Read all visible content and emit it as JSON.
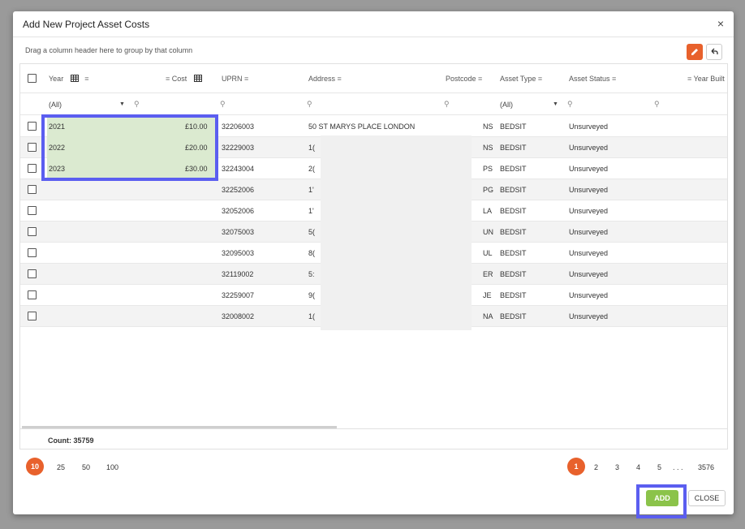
{
  "dialog": {
    "title": "Add New Project Asset Costs",
    "close_glyph": "×",
    "group_hint": "Drag a column header here to group by that column"
  },
  "columns": {
    "year": "Year",
    "cost": "Cost",
    "uprn": "UPRN",
    "address": "Address",
    "postcode": "Postcode",
    "asset_type": "Asset Type",
    "asset_status": "Asset Status",
    "year_built": "Year Built"
  },
  "filters": {
    "year_value": "(All)",
    "asset_type_value": "(All)"
  },
  "rows": [
    {
      "year": "2021",
      "cost": "£10.00",
      "uprn": "32206003",
      "address": "50 ST MARYS PLACE LONDON",
      "postcode": "NS",
      "asset_type": "BEDSIT",
      "asset_status": "Unsurveyed"
    },
    {
      "year": "2022",
      "cost": "£20.00",
      "uprn": "32229003",
      "address": "1(",
      "postcode": "NS",
      "asset_type": "BEDSIT",
      "asset_status": "Unsurveyed"
    },
    {
      "year": "2023",
      "cost": "£30.00",
      "uprn": "32243004",
      "address": "2(",
      "postcode": "PS",
      "asset_type": "BEDSIT",
      "asset_status": "Unsurveyed"
    },
    {
      "year": "",
      "cost": "",
      "uprn": "32252006",
      "address": "1'",
      "postcode": "PG",
      "asset_type": "BEDSIT",
      "asset_status": "Unsurveyed"
    },
    {
      "year": "",
      "cost": "",
      "uprn": "32052006",
      "address": "1'",
      "postcode": "LA",
      "asset_type": "BEDSIT",
      "asset_status": "Unsurveyed"
    },
    {
      "year": "",
      "cost": "",
      "uprn": "32075003",
      "address": "5(",
      "postcode": "UN",
      "asset_type": "BEDSIT",
      "asset_status": "Unsurveyed"
    },
    {
      "year": "",
      "cost": "",
      "uprn": "32095003",
      "address": "8(",
      "postcode": "UL",
      "asset_type": "BEDSIT",
      "asset_status": "Unsurveyed"
    },
    {
      "year": "",
      "cost": "",
      "uprn": "32119002",
      "address": "5:",
      "postcode": "ER",
      "asset_type": "BEDSIT",
      "asset_status": "Unsurveyed"
    },
    {
      "year": "",
      "cost": "",
      "uprn": "32259007",
      "address": "9(",
      "postcode": "JE",
      "asset_type": "BEDSIT",
      "asset_status": "Unsurveyed"
    },
    {
      "year": "",
      "cost": "",
      "uprn": "32008002",
      "address": "1(",
      "postcode": "NA",
      "asset_type": "BEDSIT",
      "asset_status": "Unsurveyed"
    }
  ],
  "footer": {
    "count": "Count: 35759"
  },
  "page_sizes": [
    "10",
    "25",
    "50",
    "100"
  ],
  "pages": [
    "1",
    "2",
    "3",
    "4",
    "5",
    ". . .",
    "3576"
  ],
  "buttons": {
    "add": "ADD",
    "close": "CLOSE"
  },
  "colors": {
    "accent": "#e8612c",
    "add_green": "#8bc34a",
    "highlight_blue": "#5b5ef0",
    "selected_green": "#dbead0"
  }
}
